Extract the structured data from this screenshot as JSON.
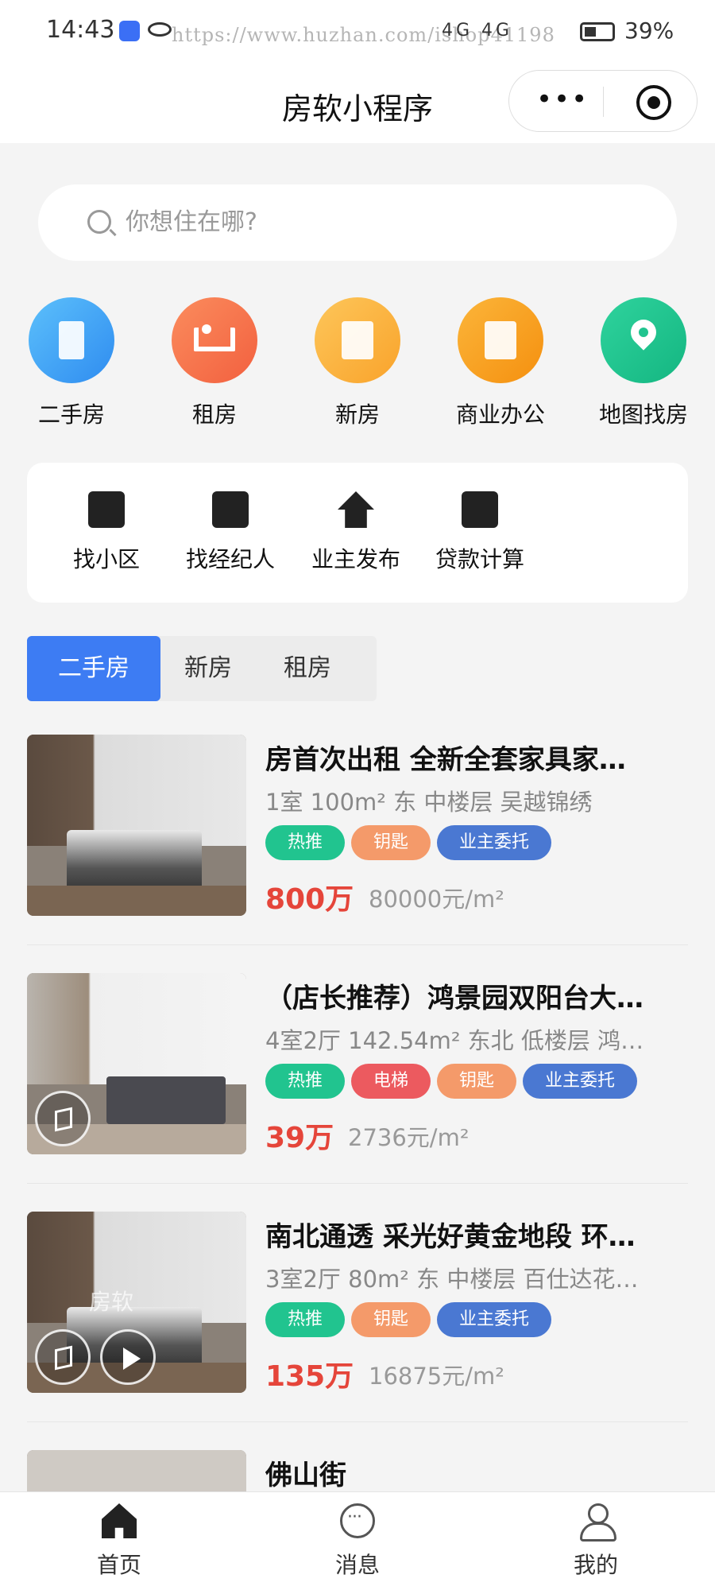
{
  "status_bar": {
    "time": "14:43",
    "watermark": "https://www.huzhan.com/ishop41198",
    "signal_text": "4G 4G",
    "battery": "39%"
  },
  "nav": {
    "title": "房软小程序",
    "more_icon": "more-dots-icon",
    "close_icon": "target-icon"
  },
  "search": {
    "placeholder": "你想住在哪?"
  },
  "categories": [
    {
      "label": "二手房",
      "icon": "building-icon",
      "color": "#3ea4f6"
    },
    {
      "label": "租房",
      "icon": "bed-icon",
      "color": "#f4734a"
    },
    {
      "label": "新房",
      "icon": "apartment-icon",
      "color": "#fbb03b"
    },
    {
      "label": "商业办公",
      "icon": "office-icon",
      "color": "#f8a017"
    },
    {
      "label": "地图找房",
      "icon": "map-pin-icon",
      "color": "#21c48f"
    }
  ],
  "tools": [
    {
      "label": "找小区",
      "icon": "community-icon"
    },
    {
      "label": "找经纪人",
      "icon": "agent-badge-icon"
    },
    {
      "label": "业主发布",
      "icon": "owner-publish-icon"
    },
    {
      "label": "贷款计算",
      "icon": "calculator-icon"
    }
  ],
  "tabs": [
    {
      "label": "二手房",
      "active": true
    },
    {
      "label": "新房",
      "active": false
    },
    {
      "label": "租房",
      "active": false
    }
  ],
  "listings": [
    {
      "title": "房首次出租 全新全套家具家…",
      "info": "1室 100m² 东 中楼层 吴越锦绣",
      "tags": [
        {
          "text": "热推",
          "color": "#21c48f"
        },
        {
          "text": "钥匙",
          "color": "#f49a6a"
        },
        {
          "text": "业主委托",
          "color": "#4a78d2"
        }
      ],
      "price": "800万",
      "unit_price": "80000元/m²"
    },
    {
      "title": "（店长推荐）鸿景园双阳台大…",
      "info": "4室2厅 142.54m² 东北 低楼层 鸿…",
      "tags": [
        {
          "text": "热推",
          "color": "#21c48f"
        },
        {
          "text": "电梯",
          "color": "#ec5a5f"
        },
        {
          "text": "钥匙",
          "color": "#f49a6a"
        },
        {
          "text": "业主委托",
          "color": "#4a78d2"
        }
      ],
      "price": "39万",
      "unit_price": "2736元/m²"
    },
    {
      "title": "南北通透 采光好黄金地段 环…",
      "info": "3室2厅 80m² 东 中楼层 百仕达花…",
      "tags": [
        {
          "text": "热推",
          "color": "#21c48f"
        },
        {
          "text": "钥匙",
          "color": "#f49a6a"
        },
        {
          "text": "业主委托",
          "color": "#4a78d2"
        }
      ],
      "price": "135万",
      "unit_price": "16875元/m²",
      "image_watermark": "房软"
    },
    {
      "title": "佛山街"
    }
  ],
  "tabbar": [
    {
      "label": "首页",
      "icon": "home-icon"
    },
    {
      "label": "消息",
      "icon": "message-icon"
    },
    {
      "label": "我的",
      "icon": "profile-icon"
    }
  ]
}
